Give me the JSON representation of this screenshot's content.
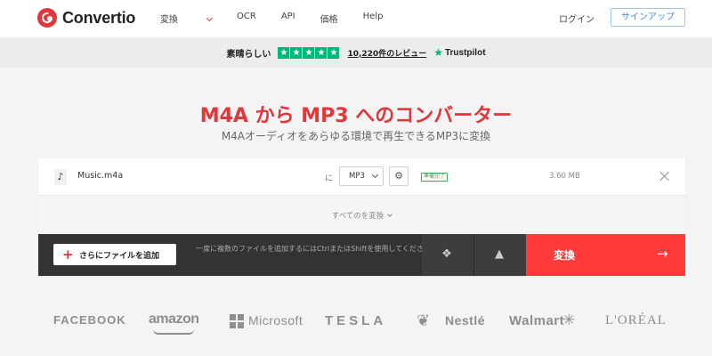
{
  "nav": {
    "logo_text": "Convertio",
    "menu": [
      {
        "label": "変換",
        "has_dropdown": true
      },
      {
        "label": "OCR"
      },
      {
        "label": "API"
      },
      {
        "label": "価格"
      },
      {
        "label": "Help"
      }
    ],
    "login": "ログイン",
    "signup": "サインアップ"
  },
  "trust": {
    "rating_text": "素晴らしい",
    "stars": 5,
    "reviews_link": "10,220件のレビュー",
    "provider": "Trustpilot"
  },
  "hero": {
    "title": "M4A から MP3 へのコンバーター",
    "subtitle": "M4Aオーディオをあらゆる環境で再生できるMP3に変換"
  },
  "file": {
    "icon": "music-note-icon",
    "name": "Music.m4a",
    "to_label": "に",
    "format": "MP3",
    "status": "準備完了",
    "size": "3.60 MB"
  },
  "convert_all": "すべてのを変換",
  "actions": {
    "add_files": "さらにファイルを追加",
    "hint": "一度に複数のファイルを追加するにはCtrlまたはShiftを使用してください",
    "convert": "変換"
  },
  "brands": [
    "FACEBOOK",
    "amazon",
    "Microsoft",
    "TESLA",
    "Nestlé",
    "Walmart",
    "L'ORÉAL"
  ],
  "colors": {
    "accent": "#e1363a",
    "convert_button": "#ff3b3b",
    "trustpilot_green": "#00b67a",
    "ready_green": "#3ba552"
  }
}
